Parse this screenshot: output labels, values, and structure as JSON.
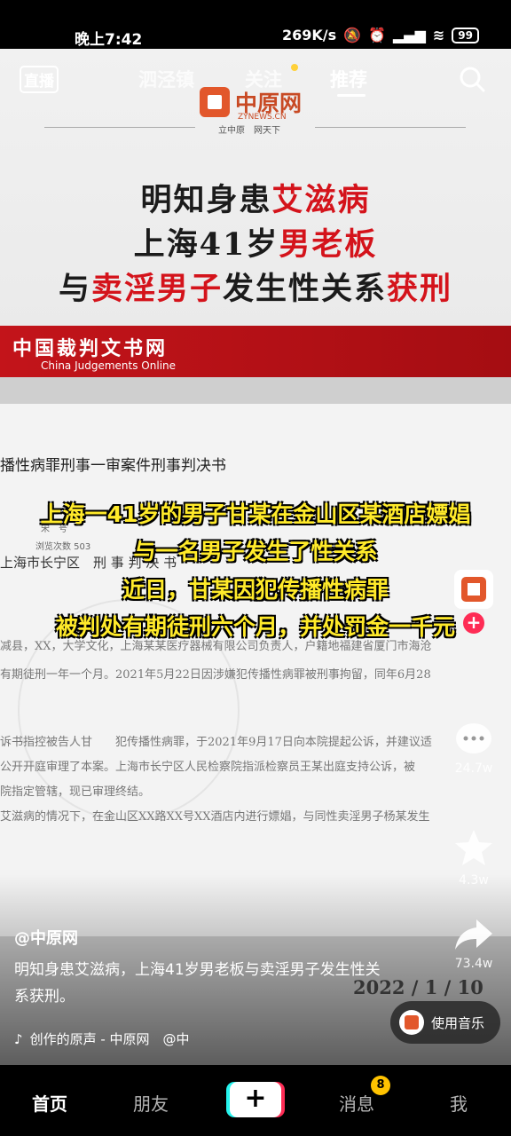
{
  "status": {
    "time": "晚上7:42",
    "speed": "269K/s",
    "battery": "99"
  },
  "nav": {
    "live": "直播",
    "tabs": [
      "泗泾镇",
      "关注",
      "推荐"
    ],
    "active_tab": "推荐"
  },
  "banner": {
    "logo_text": "中原网",
    "logo_sub": "ZYNEWS.CN",
    "slogan": "立中原　网天下",
    "line1_a": "明知身患",
    "line1_b": "艾滋病",
    "line2_a": "上海41岁",
    "line2_b": "男老板",
    "line3_a": "与",
    "line3_b": "卖淫男子",
    "line3_c": "发生性关系",
    "line3_d": "获刑",
    "cjo_cn": "中国裁判文书网",
    "cjo_en": "China Judgements Online"
  },
  "doc": {
    "title": "播性病罪刑事一审案件刑事判决书",
    "field_a": "宋　号",
    "views": "浏览次数 503",
    "court": "上海市长宁区",
    "court_b": "刑 事 判 决 书",
    "line1": "减县，XX，大学文化，上海某某医疗器械有限公司负责人，户籍地福建省厦门市海沧",
    "line2": "有期徒刑一年一个月。2021年5月22日因涉嫌犯传播性病罪被刑事拘留，同年6月28",
    "line3": "诉书指控被告人甘　　犯传播性病罪，于2021年9月17日向本院提起公诉，并建议适",
    "line4": "公开开庭审理了本案。上海市长宁区人民检察院指派检察员王某出庭支持公诉，被",
    "line5": "院指定管辖，现已审理终结。",
    "line6": "艾滋病的情况下，在金山区XX路XX号XX酒店内进行嫖娼，与同性卖淫男子杨某发生",
    "date": "2022 / 1 / 10"
  },
  "subtitles": [
    "上海一41岁的男子甘某在金山区某酒店嫖娼",
    "与一名男子发生了性关系",
    "近日，甘某因犯传播性病罪",
    "被判处有期徒刑六个月，并处罚金一千元"
  ],
  "rail": {
    "comments": "24.7w",
    "favorites": "4.3w",
    "shares": "73.4w"
  },
  "post": {
    "author": "@中原网",
    "caption": "明知身患艾滋病，上海41岁男老板与卖淫男子发生性关系获刑。",
    "music": "创作的原声 - 中原网　@中",
    "use_music": "使用音乐"
  },
  "tabbar": {
    "home": "首页",
    "friends": "朋友",
    "create": "+",
    "messages": "消息",
    "messages_badge": "8",
    "me": "我"
  }
}
